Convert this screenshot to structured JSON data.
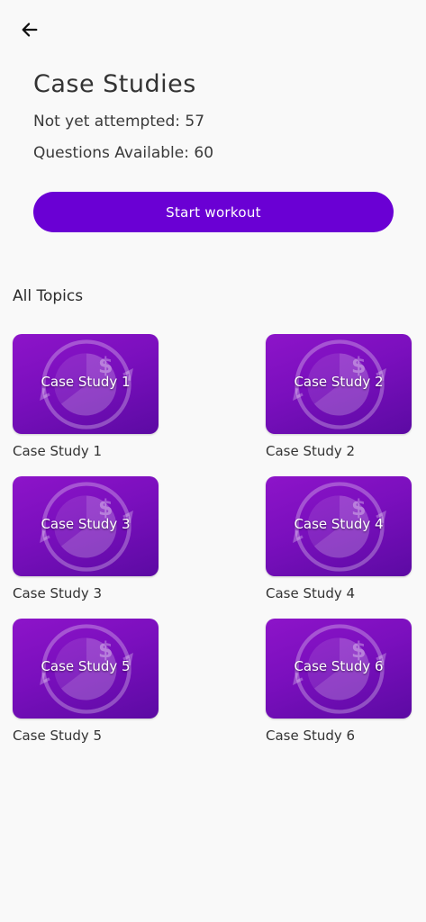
{
  "header": {
    "back_icon": "arrow-left-icon",
    "title": "Case Studies"
  },
  "stats": {
    "not_attempted": "Not yet attempted: 57",
    "available": "Questions Available: 60"
  },
  "start_button": {
    "label": "Start workout",
    "color": "#6a00d4"
  },
  "topics": {
    "heading": "All Topics",
    "thumbnail_icon": "pie-chart-dollar-icon",
    "items": [
      {
        "thumb_label": "Case Study 1",
        "caption": "Case Study 1"
      },
      {
        "thumb_label": "Case Study 2",
        "caption": "Case Study 2"
      },
      {
        "thumb_label": "Case Study 3",
        "caption": "Case Study 3"
      },
      {
        "thumb_label": "Case Study 4",
        "caption": "Case Study 4"
      },
      {
        "thumb_label": "Case Study 5",
        "caption": "Case Study 5"
      },
      {
        "thumb_label": "Case Study 6",
        "caption": "Case Study 6"
      }
    ]
  },
  "colors": {
    "accent": "#6a00d4",
    "thumb_top": "#8d14c9",
    "thumb_bottom": "#5c0aa3",
    "background": "#f9f9f9"
  }
}
